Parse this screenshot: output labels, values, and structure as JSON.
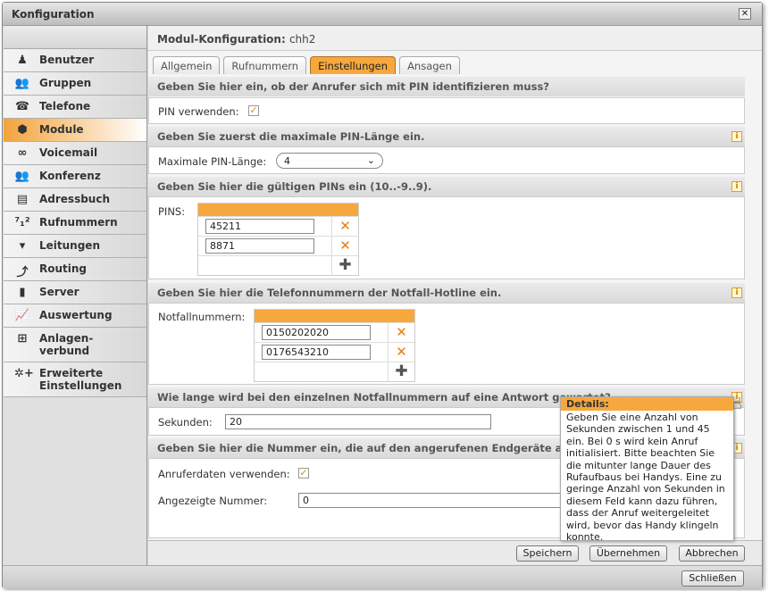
{
  "window": {
    "title": "Konfiguration",
    "close_icon": "close-icon"
  },
  "sidebar": {
    "items": [
      {
        "label": "Benutzer",
        "icon": "user-icon",
        "glyph": "♟"
      },
      {
        "label": "Gruppen",
        "icon": "group-icon",
        "glyph": "👥"
      },
      {
        "label": "Telefone",
        "icon": "phone-icon",
        "glyph": "☎"
      },
      {
        "label": "Module",
        "icon": "module-icon",
        "glyph": "⬢",
        "active": true
      },
      {
        "label": "Voicemail",
        "icon": "voicemail-icon",
        "glyph": "∞"
      },
      {
        "label": "Konferenz",
        "icon": "conference-icon",
        "glyph": "👥"
      },
      {
        "label": "Adressbuch",
        "icon": "addressbook-icon",
        "glyph": "▤"
      },
      {
        "label": "Rufnummern",
        "icon": "numbers-icon",
        "glyph": "⁷₁²"
      },
      {
        "label": "Leitungen",
        "icon": "lines-icon",
        "glyph": "▾"
      },
      {
        "label": "Routing",
        "icon": "routing-icon",
        "glyph": "⤴"
      },
      {
        "label": "Server",
        "icon": "server-icon",
        "glyph": "▮"
      },
      {
        "label": "Auswertung",
        "icon": "chart-icon",
        "glyph": "📈"
      },
      {
        "label": "Anlagen-\nverbund",
        "icon": "network-icon",
        "glyph": "⊞"
      },
      {
        "label": "Erweiterte\nEinstellungen",
        "icon": "advanced-settings-icon",
        "glyph": "✲+"
      }
    ]
  },
  "main": {
    "title_label": "Modul-Konfiguration:",
    "title_value": "chh2",
    "tabs": [
      {
        "label": "Allgemein"
      },
      {
        "label": "Rufnummern"
      },
      {
        "label": "Einstellungen",
        "active": true
      },
      {
        "label": "Ansagen"
      }
    ],
    "sections": {
      "pin": {
        "heading": "Geben Sie hier ein, ob der Anrufer sich mit PIN identifizieren muss?",
        "label": "PIN verwenden:",
        "checked": true
      },
      "pinlen": {
        "heading": "Geben Sie zuerst die maximale PIN-Länge ein.",
        "label": "Maximale PIN-Länge:",
        "value": "4"
      },
      "pins": {
        "heading": "Geben Sie hier die gültigen PINs ein (10..-9..9).",
        "label": "PINS:",
        "values": [
          "45211",
          "8871"
        ]
      },
      "hotline": {
        "heading": "Geben Sie hier die Telefonnummern der Notfall-Hotline ein.",
        "label": "Notfallnummern:",
        "values": [
          "0150202020",
          "0176543210"
        ]
      },
      "wait": {
        "heading": "Wie lange wird bei den einzelnen Notfallnummern auf eine Antwort gewartet?",
        "label": "Sekunden:",
        "value": "20"
      },
      "caller": {
        "heading": "Geben Sie hier die Nummer ein, die auf den angerufenen Endgeräte angezeigt werden soll.",
        "label": "Anruferdaten verwenden:",
        "checked": true,
        "num_label": "Angezeigte Nummer:",
        "num_value": "0"
      }
    },
    "buttons": {
      "save": "Speichern",
      "apply": "Übernehmen",
      "cancel": "Abbrechen"
    }
  },
  "tooltip": {
    "title": "Details:",
    "text": "Geben Sie eine Anzahl von Sekunden zwischen 1 und 45 ein. Bei 0 s wird kein Anruf initialisiert. Bitte beachten Sie die mitunter lange Dauer des Rufaufbaus bei Handys. Eine zu geringe Anzahl von Sekunden in diesem Feld kann dazu führen, dass der Anruf weitergeleitet wird, bevor das Handy klingeln konnte."
  },
  "footer": {
    "close": "Schließen"
  },
  "colors": {
    "accent": "#f6a83e",
    "delete": "#e0801a"
  }
}
